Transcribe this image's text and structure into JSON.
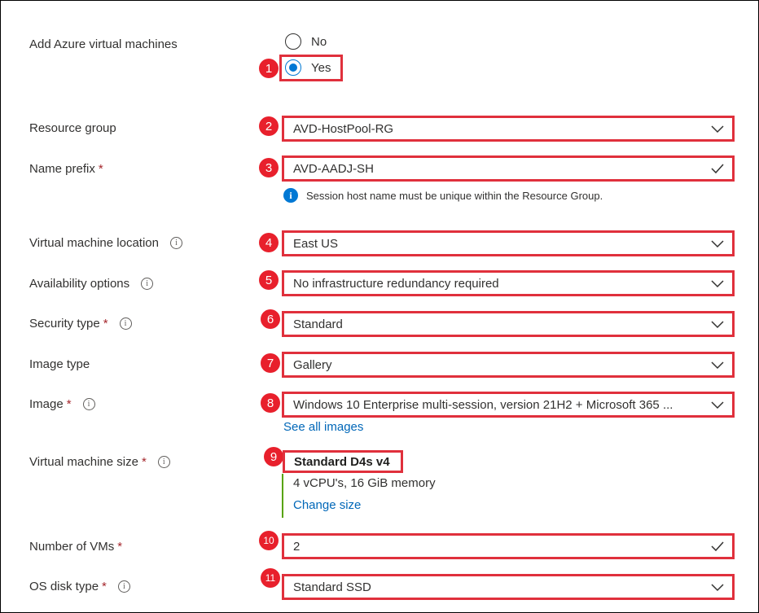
{
  "form": {
    "add_vms": {
      "label": "Add Azure virtual machines",
      "options": [
        "No",
        "Yes"
      ],
      "selected": "Yes"
    },
    "resource_group": {
      "label": "Resource group",
      "value": "AVD-HostPool-RG"
    },
    "name_prefix": {
      "label": "Name prefix",
      "value": "AVD-AADJ-SH",
      "hint": "Session host name must be unique within the Resource Group."
    },
    "vm_location": {
      "label": "Virtual machine location",
      "value": "East US"
    },
    "availability": {
      "label": "Availability options",
      "value": "No infrastructure redundancy required"
    },
    "security_type": {
      "label": "Security type",
      "value": "Standard"
    },
    "image_type": {
      "label": "Image type",
      "value": "Gallery"
    },
    "image": {
      "label": "Image",
      "value": "Windows 10 Enterprise multi-session, version 21H2 + Microsoft 365 ...",
      "link": "See all images"
    },
    "vm_size": {
      "label": "Virtual machine size",
      "value": "Standard D4s v4",
      "spec": "4 vCPU's, 16 GiB memory",
      "link": "Change size"
    },
    "num_vms": {
      "label": "Number of VMs",
      "value": "2"
    },
    "os_disk": {
      "label": "OS disk type",
      "value": "Standard SSD"
    },
    "required_mark": "*",
    "info_glyph": "i"
  },
  "badges": [
    "1",
    "2",
    "3",
    "4",
    "5",
    "6",
    "7",
    "8",
    "9",
    "10",
    "11"
  ],
  "colors": {
    "accent": "#0078d4",
    "callout_red": "#e0303c",
    "link": "#0067b8",
    "required": "#a4262c",
    "size_bar": "#57a300"
  }
}
